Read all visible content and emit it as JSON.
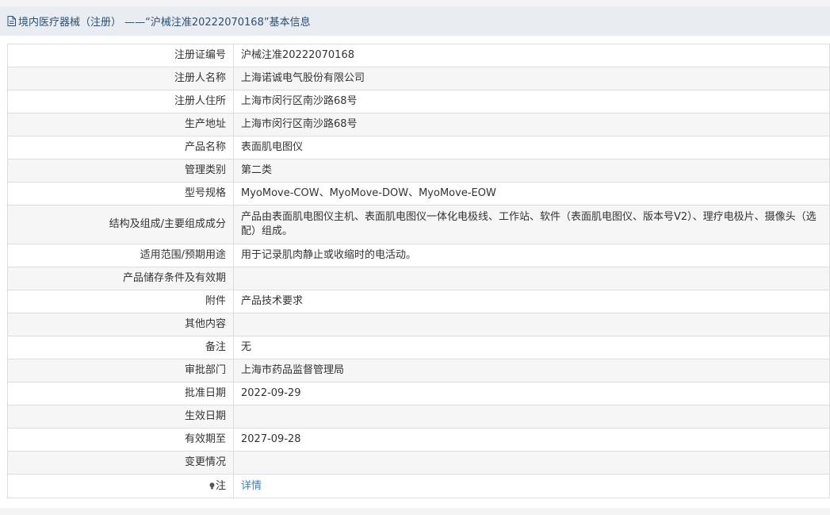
{
  "header": {
    "title": "境内医疗器械（注册） ——“沪械注准20222070168”基本信息",
    "icon": "document-icon"
  },
  "rows": [
    {
      "label": "注册证编号",
      "value": "沪械注准20222070168"
    },
    {
      "label": "注册人名称",
      "value": "上海诺诚电气股份有限公司"
    },
    {
      "label": "注册人住所",
      "value": "上海市闵行区南沙路68号"
    },
    {
      "label": "生产地址",
      "value": "上海市闵行区南沙路68号"
    },
    {
      "label": "产品名称",
      "value": "表面肌电图仪"
    },
    {
      "label": "管理类别",
      "value": "第二类"
    },
    {
      "label": "型号规格",
      "value": "MyoMove-COW、MyoMove-DOW、MyoMove-EOW"
    },
    {
      "label": "结构及组成/主要组成成分",
      "value": "产品由表面肌电图仪主机、表面肌电图仪一体化电极线、工作站、软件（表面肌电图仪、版本号V2）、理疗电极片、摄像头（选配）组成。"
    },
    {
      "label": "适用范围/预期用途",
      "value": "用于记录肌肉静止或收缩时的电活动。"
    },
    {
      "label": "产品储存条件及有效期",
      "value": ""
    },
    {
      "label": "附件",
      "value": "产品技术要求"
    },
    {
      "label": "其他内容",
      "value": ""
    },
    {
      "label": "备注",
      "value": "无"
    },
    {
      "label": "审批部门",
      "value": "上海市药品监督管理局"
    },
    {
      "label": "批准日期",
      "value": "2022-09-29"
    },
    {
      "label": "生效日期",
      "value": ""
    },
    {
      "label": "有效期至",
      "value": "2027-09-28"
    },
    {
      "label": "变更情况",
      "value": ""
    }
  ],
  "note": {
    "label": "注",
    "link": "详情",
    "icon": "bulb-icon"
  },
  "colors": {
    "header_bg": "#e9ecf0",
    "header_text": "#2a4f78",
    "link": "#3a7dc9",
    "border": "#dddddd",
    "alt_row": "#f6f6f6"
  }
}
